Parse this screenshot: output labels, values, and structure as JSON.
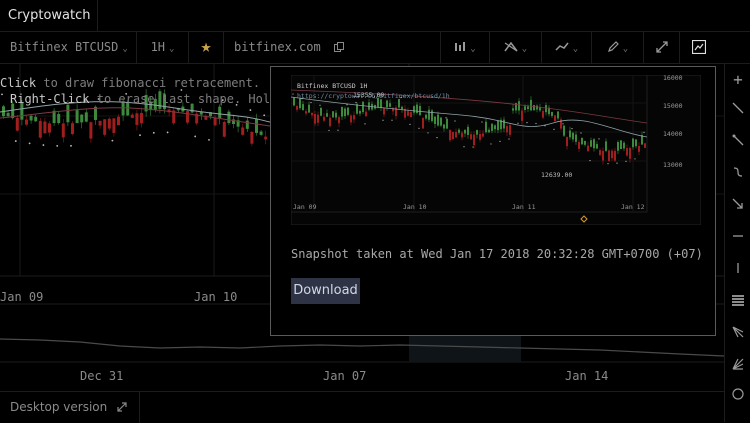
{
  "app": {
    "title": "Cryptowatch"
  },
  "toolbar": {
    "market": "Bitfinex BTCUSD",
    "period": "1H",
    "exchange_link": "bitfinex.com"
  },
  "main_chart": {
    "hint_line1_pre": "Click",
    "hint_line1_post": "to draw fibonacci retracement.",
    "hint_line2_pre": "Right-Click",
    "hint_line2_post": "to erase last shape. Hold",
    "x_labels": [
      "Jan 09",
      "Jan 10"
    ],
    "overview_x_labels": [
      "Dec 31",
      "Jan 07",
      "Jan 14"
    ]
  },
  "snapshot": {
    "chart_title": "Bitfinex BTCUSD 1H",
    "chart_url": "https://cryptowat.ch/bitfinex/btcusd/1h",
    "high_label": "15355.00",
    "low_label": "12639.00",
    "y_ticks": [
      "16000",
      "15000",
      "14000",
      "13000"
    ],
    "x_ticks": [
      "Jan 09",
      "Jan 10",
      "Jan 11",
      "Jan 12"
    ],
    "caption": "Snapshot taken at Wed Jan 17 2018 20:32:28 GMT+0700 (+07)",
    "download_label": "Download"
  },
  "footer": {
    "desktop_label": "Desktop version"
  }
}
